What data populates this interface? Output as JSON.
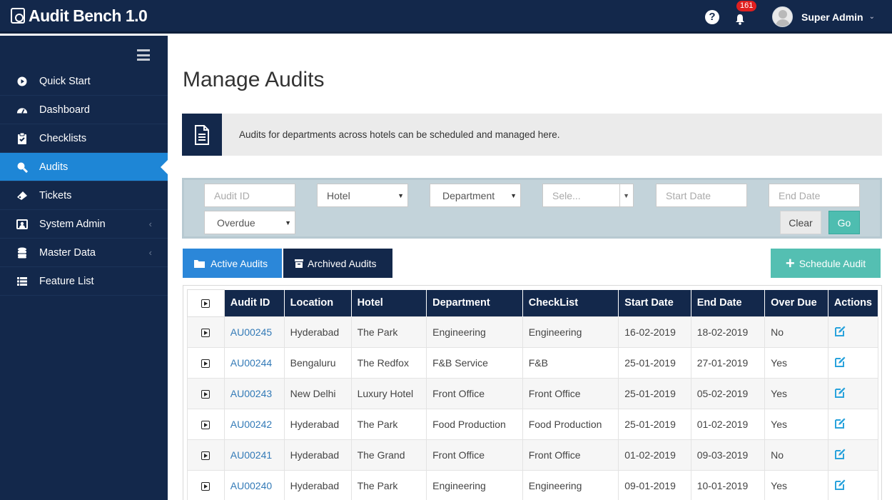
{
  "app": {
    "title": "Audit Bench 1.0"
  },
  "header": {
    "help_label": "?",
    "notification_count": "161",
    "user_name": "Super Admin",
    "caret": "⌄"
  },
  "sidebar": {
    "items": [
      {
        "label": "Quick Start",
        "icon": "play-circle-icon",
        "active": false
      },
      {
        "label": "Dashboard",
        "icon": "gauge-icon",
        "active": false
      },
      {
        "label": "Checklists",
        "icon": "clipboard-check-icon",
        "active": false
      },
      {
        "label": "Audits",
        "icon": "magnify-icon",
        "active": true
      },
      {
        "label": "Tickets",
        "icon": "ticket-icon",
        "active": false
      },
      {
        "label": "System Admin",
        "icon": "admin-icon",
        "active": false,
        "chevron": "‹"
      },
      {
        "label": "Master Data",
        "icon": "database-icon",
        "active": false,
        "chevron": "‹"
      },
      {
        "label": "Feature List",
        "icon": "list-icon",
        "active": false
      }
    ]
  },
  "main": {
    "title": "Manage Audits",
    "info_text": "Audits for departments across hotels can be scheduled and managed here.",
    "filters": {
      "audit_id_placeholder": "Audit ID",
      "hotel": "Hotel",
      "department": "Department",
      "select_placeholder": "Sele...",
      "start_date_placeholder": "Start Date",
      "end_date_placeholder": "End Date",
      "overdue": "Overdue",
      "clear_label": "Clear",
      "go_label": "Go",
      "select_arrow": "▼"
    },
    "tabs": {
      "active_label": "Active Audits",
      "archived_label": "Archived Audits"
    },
    "schedule_label": "Schedule Audit",
    "schedule_plus": "+",
    "table": {
      "columns": [
        "Audit ID",
        "Location",
        "Hotel",
        "Department",
        "CheckList",
        "Start Date",
        "End Date",
        "Over Due",
        "Actions"
      ],
      "rows": [
        [
          "AU00245",
          "Hyderabad",
          "The Park",
          "Engineering",
          "Engineering",
          "16-02-2019",
          "18-02-2019",
          "No"
        ],
        [
          "AU00244",
          "Bengaluru",
          "The Redfox",
          "F&B Service",
          "F&B",
          "25-01-2019",
          "27-01-2019",
          "Yes"
        ],
        [
          "AU00243",
          "New Delhi",
          "Luxury Hotel",
          "Front Office",
          "Front Office",
          "25-01-2019",
          "05-02-2019",
          "Yes"
        ],
        [
          "AU00242",
          "Hyderabad",
          "The Park",
          "Food Production",
          "Food Production",
          "25-01-2019",
          "01-02-2019",
          "Yes"
        ],
        [
          "AU00241",
          "Hyderabad",
          "The Grand",
          "Front Office",
          "Front Office",
          "01-02-2019",
          "09-03-2019",
          "No"
        ],
        [
          "AU00240",
          "Hyderabad",
          "The Park",
          "Engineering",
          "Engineering",
          "09-01-2019",
          "10-01-2019",
          "Yes"
        ]
      ]
    }
  },
  "colors": {
    "navy": "#13284b",
    "active_blue": "#1e86d6",
    "teal": "#4ebdb0",
    "link": "#337ab7",
    "badge_red": "#e02020"
  }
}
